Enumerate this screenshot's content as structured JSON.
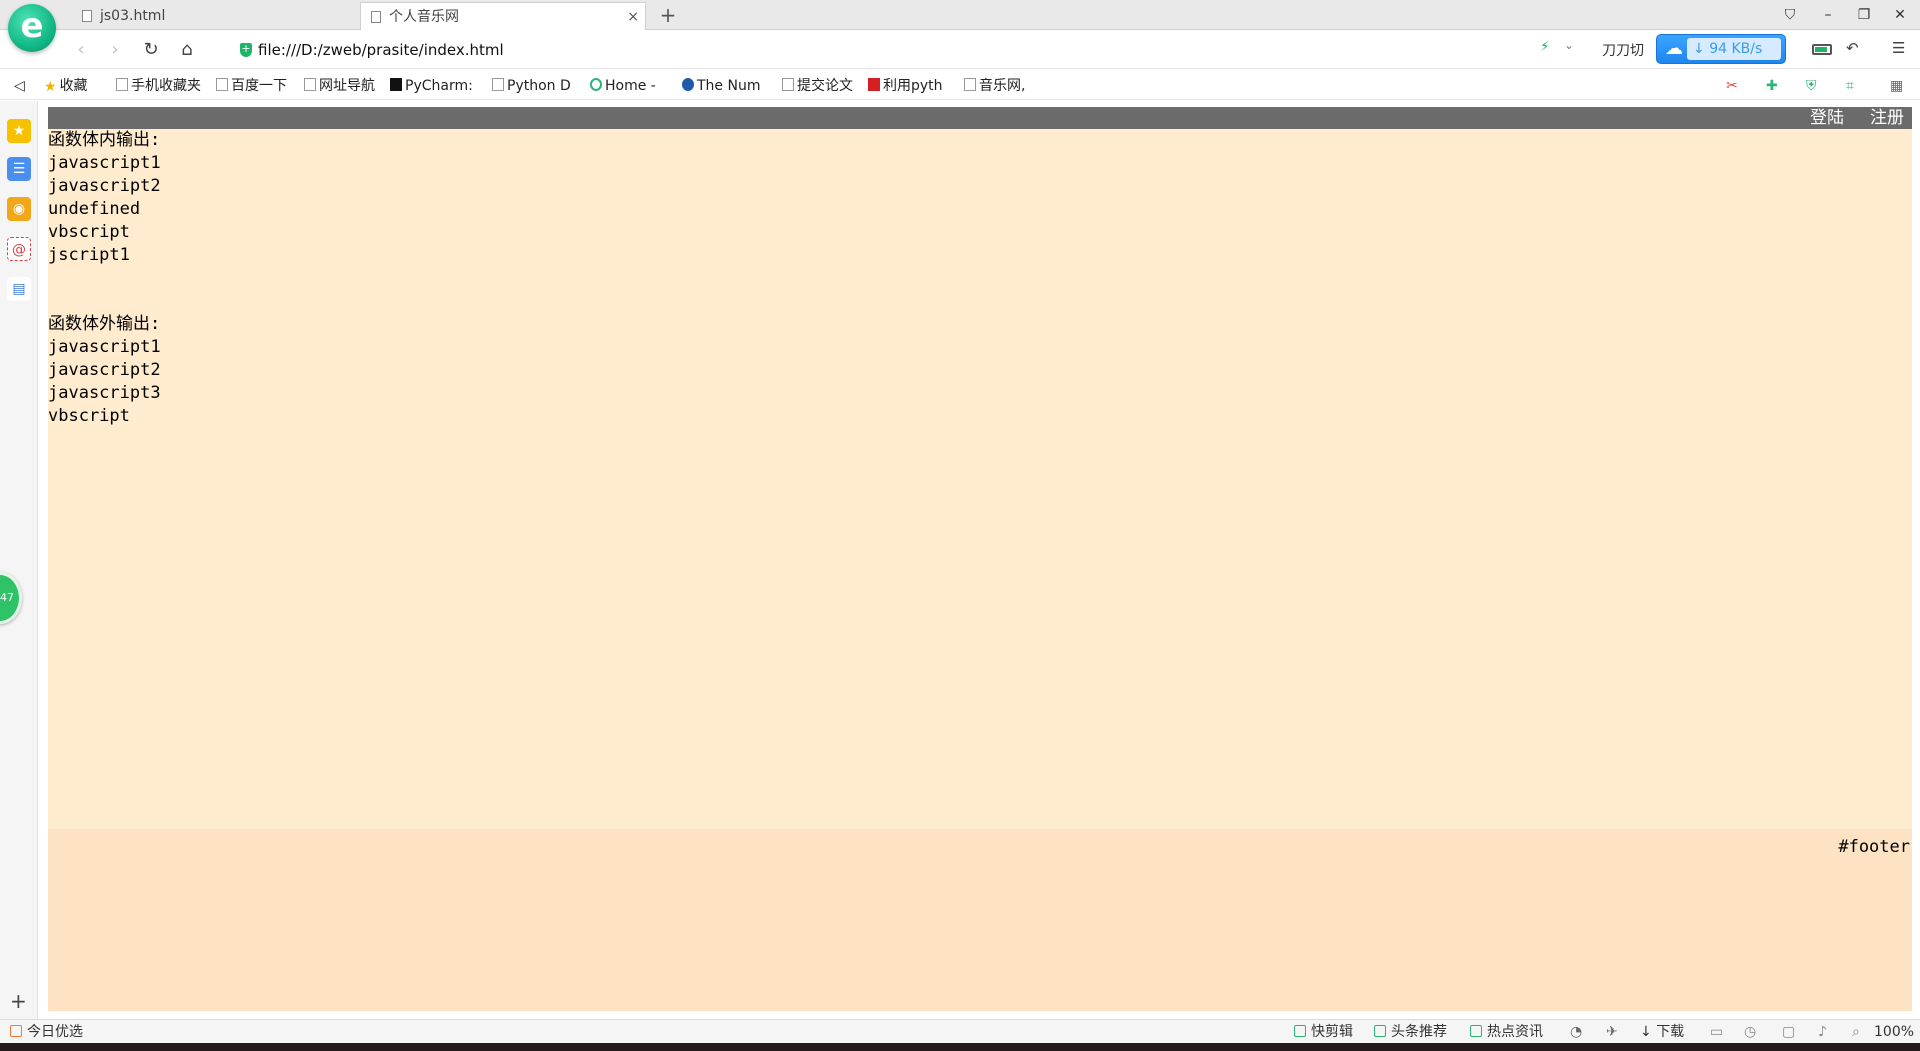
{
  "tabs": [
    {
      "title": "js03.html",
      "active": false
    },
    {
      "title": "个人音乐网",
      "active": true
    }
  ],
  "tab_close": "×",
  "new_tab": "+",
  "window_controls": {
    "shirt": "⛉",
    "minimize": "–",
    "restore": "❐",
    "close": "✕"
  },
  "nav": {
    "back": "‹",
    "forward": "›",
    "reload": "↻",
    "home": "⌂"
  },
  "address": {
    "url": "file:///D:/zweb/prasite/index.html"
  },
  "toolbar_right": {
    "daodao": "刀刀切",
    "download_speed": "94 KB/s",
    "undo": "↶",
    "menu": "☰"
  },
  "bookmarks": {
    "toggle": "◁",
    "items": [
      {
        "label": "收藏",
        "icon": "star-icon"
      },
      {
        "label": "手机收藏夹",
        "icon": "phone-icon"
      },
      {
        "label": "百度一下",
        "icon": "page-icon"
      },
      {
        "label": "网址导航",
        "icon": "page-icon"
      },
      {
        "label": "PyCharm:",
        "icon": "jetbrains-icon"
      },
      {
        "label": "Python D",
        "icon": "page-icon"
      },
      {
        "label": "Home -",
        "icon": "circle-icon"
      },
      {
        "label": "The Num",
        "icon": "numpy-icon"
      },
      {
        "label": "提交论文",
        "icon": "pen-icon"
      },
      {
        "label": "利用pyth",
        "icon": "csdn-icon"
      },
      {
        "label": "音乐网,",
        "icon": "layers-icon"
      }
    ]
  },
  "sidebar": {
    "bubble": "47",
    "add": "+"
  },
  "page": {
    "nav_links": [
      "登陆",
      "注册"
    ],
    "lines": [
      "函数体内输出:",
      "javascript1",
      "javascript2",
      "undefined",
      "vbscript",
      "jscript1",
      "",
      "",
      "函数体外输出:",
      "javascript1",
      "javascript2",
      "javascript3",
      "vbscript"
    ],
    "footer_label": "#footer"
  },
  "status_bar": {
    "left": "今日优选",
    "items": [
      "快剪辑",
      "头条推荐",
      "热点资讯",
      "下载"
    ],
    "zoom": "100%"
  },
  "colors": {
    "page_bg": "#ffebcd",
    "nav_bg": "#6b6b6b",
    "footer_bg": "#fde3c3",
    "accent_green": "#2bb673",
    "speed_blue": "#1f86f0"
  }
}
